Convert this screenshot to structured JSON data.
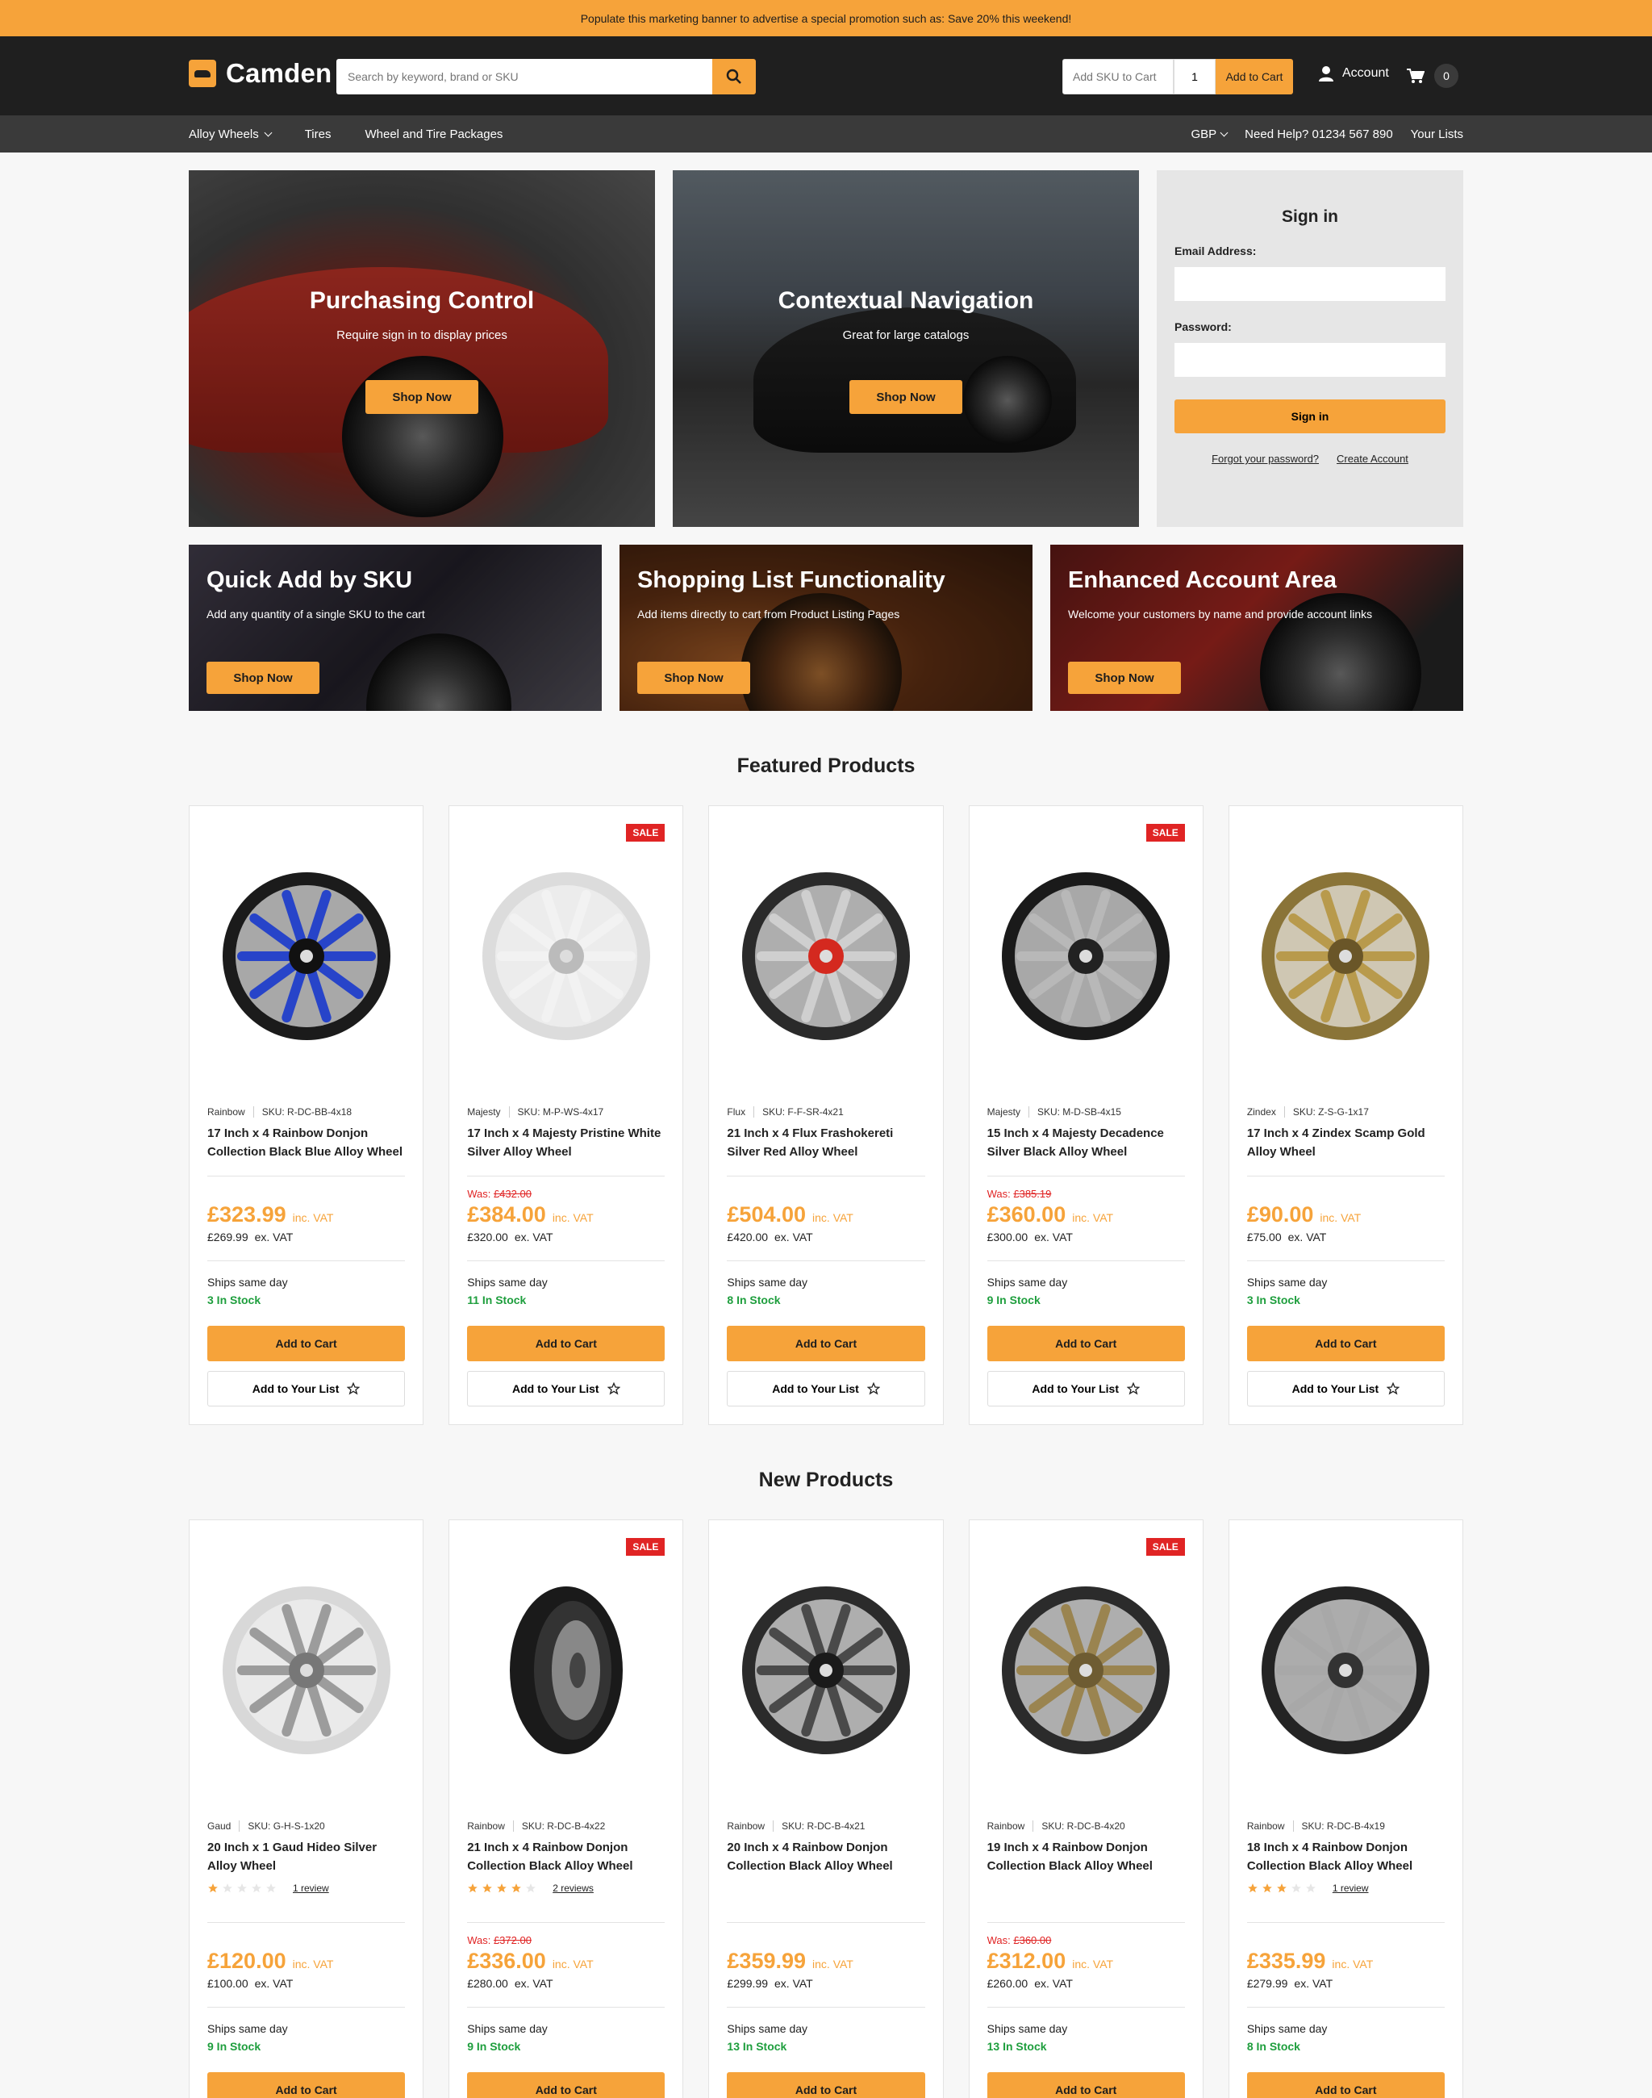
{
  "promo_banner": "Populate this marketing banner to advertise a special promotion such as: Save 20% this weekend!",
  "brand": "Camden",
  "search": {
    "placeholder": "Search by keyword, brand or SKU"
  },
  "quick_add": {
    "sku_placeholder": "Add SKU to Cart",
    "qty": "1",
    "button": "Add to Cart"
  },
  "account_label": "Account",
  "cart_count": "0",
  "nav": {
    "items": [
      "Alloy Wheels",
      "Tires",
      "Wheel and Tire Packages"
    ],
    "currency": "GBP",
    "help": "Need Help? 01234 567 890",
    "lists": "Your Lists"
  },
  "hero": [
    {
      "title": "Purchasing Control",
      "sub": "Require sign in to display prices",
      "cta": "Shop Now"
    },
    {
      "title": "Contextual Navigation",
      "sub": "Great for large catalogs",
      "cta": "Shop Now"
    }
  ],
  "signin": {
    "title": "Sign in",
    "email_label": "Email Address:",
    "password_label": "Password:",
    "button": "Sign in",
    "forgot": "Forgot your password?",
    "create": "Create Account"
  },
  "promos": [
    {
      "title": "Quick Add by SKU",
      "sub": "Add any quantity of a single SKU to the cart",
      "cta": "Shop Now"
    },
    {
      "title": "Shopping List Functionality",
      "sub": "Add items directly to cart from Product Listing Pages",
      "cta": "Shop Now"
    },
    {
      "title": "Enhanced Account Area",
      "sub": "Welcome your customers by name and provide account links",
      "cta": "Shop Now"
    }
  ],
  "featured_title": "Featured Products",
  "new_title": "New Products",
  "labels": {
    "inc_vat": "inc. VAT",
    "ex_vat": "ex. VAT",
    "add_cart": "Add to Cart",
    "add_list": "Add to Your List",
    "sale": "SALE",
    "was": "Was: "
  },
  "featured": [
    {
      "brand": "Rainbow",
      "sku": "SKU: R-DC-BB-4x18",
      "name": "17 Inch x 4 Rainbow Donjon Collection Black Blue Alloy Wheel",
      "was": "",
      "price": "£323.99",
      "ex": "£269.99",
      "ships": "Ships same day",
      "stock": "3 In Stock",
      "sale": false,
      "wheel": "blue"
    },
    {
      "brand": "Majesty",
      "sku": "SKU: M-P-WS-4x17",
      "name": "17 Inch x 4 Majesty Pristine White Silver Alloy Wheel",
      "was": "£432.00",
      "price": "£384.00",
      "ex": "£320.00",
      "ships": "Ships same day",
      "stock": "11 In Stock",
      "sale": true,
      "wheel": "white"
    },
    {
      "brand": "Flux",
      "sku": "SKU: F-F-SR-4x21",
      "name": "21 Inch x 4 Flux Frashokereti Silver Red Alloy Wheel",
      "was": "",
      "price": "£504.00",
      "ex": "£420.00",
      "ships": "Ships same day",
      "stock": "8 In Stock",
      "sale": false,
      "wheel": "silver-red"
    },
    {
      "brand": "Majesty",
      "sku": "SKU: M-D-SB-4x15",
      "name": "15 Inch x 4 Majesty Decadence Silver Black Alloy Wheel",
      "was": "£385.19",
      "price": "£360.00",
      "ex": "£300.00",
      "ships": "Ships same day",
      "stock": "9 In Stock",
      "sale": true,
      "wheel": "black-silver"
    },
    {
      "brand": "Zindex",
      "sku": "SKU: Z-S-G-1x17",
      "name": "17 Inch x 4 Zindex Scamp Gold Alloy Wheel",
      "was": "",
      "price": "£90.00",
      "ex": "£75.00",
      "ships": "Ships same day",
      "stock": "3 In Stock",
      "sale": false,
      "wheel": "gold"
    }
  ],
  "new": [
    {
      "brand": "Gaud",
      "sku": "SKU: G-H-S-1x20",
      "name": "20 Inch x 1 Gaud Hideo Silver Alloy Wheel",
      "rating": 1,
      "reviews": "1 review",
      "was": "",
      "price": "£120.00",
      "ex": "£100.00",
      "ships": "Ships same day",
      "stock": "9 In Stock",
      "sale": false,
      "wheel": "chrome"
    },
    {
      "brand": "Rainbow",
      "sku": "SKU: R-DC-B-4x22",
      "name": "21 Inch x 4 Rainbow Donjon Collection Black Alloy Wheel",
      "rating": 4,
      "reviews": "2 reviews",
      "was": "£372.00",
      "price": "£336.00",
      "ex": "£280.00",
      "ships": "Ships same day",
      "stock": "9 In Stock",
      "sale": true,
      "wheel": "tire"
    },
    {
      "brand": "Rainbow",
      "sku": "SKU: R-DC-B-4x21",
      "name": "20 Inch x 4 Rainbow Donjon Collection Black Alloy Wheel",
      "rating": 0,
      "reviews": "",
      "was": "",
      "price": "£359.99",
      "ex": "£299.99",
      "ships": "Ships same day",
      "stock": "13 In Stock",
      "sale": false,
      "wheel": "dark"
    },
    {
      "brand": "Rainbow",
      "sku": "SKU: R-DC-B-4x20",
      "name": "19 Inch x 4 Rainbow Donjon Collection Black Alloy Wheel",
      "rating": 0,
      "reviews": "",
      "was": "£360.00",
      "price": "£312.00",
      "ex": "£260.00",
      "ships": "Ships same day",
      "stock": "13 In Stock",
      "sale": true,
      "wheel": "bronze"
    },
    {
      "brand": "Rainbow",
      "sku": "SKU: R-DC-B-4x19",
      "name": "18 Inch x 4 Rainbow Donjon Collection Black Alloy Wheel",
      "rating": 3,
      "reviews": "1 review",
      "was": "",
      "price": "£335.99",
      "ex": "£279.99",
      "ships": "Ships same day",
      "stock": "8 In Stock",
      "sale": false,
      "wheel": "black-machined"
    }
  ]
}
